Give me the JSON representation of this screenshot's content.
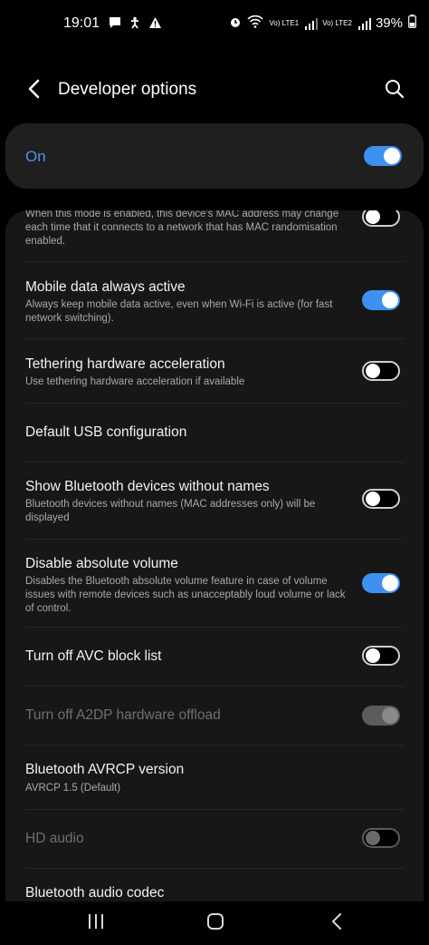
{
  "status_bar": {
    "time": "19:01",
    "left_icons": [
      "chat-icon",
      "accessibility-icon",
      "warning-icon"
    ],
    "right_icons": [
      "alarm-icon",
      "wifi-icon",
      "signal-icon"
    ],
    "sim1_label": "Vo) LTE1",
    "sim2_label": "Vo) LTE2",
    "battery": "39%"
  },
  "header": {
    "title": "Developer options",
    "back_icon": "back-icon",
    "search_icon": "search-icon"
  },
  "master_switch": {
    "label": "On",
    "state": "on"
  },
  "settings": [
    {
      "id": "mac-randomisation",
      "title": "",
      "subtitle": "When this mode is enabled, this device's MAC address may change each time that it connects to a network that has MAC randomisation enabled.",
      "toggle": "off"
    },
    {
      "id": "mobile-data-always-active",
      "title": "Mobile data always active",
      "subtitle": "Always keep mobile data active, even when Wi-Fi is active (for fast network switching).",
      "toggle": "on"
    },
    {
      "id": "tethering-hardware-acceleration",
      "title": "Tethering hardware acceleration",
      "subtitle": "Use tethering hardware acceleration if available",
      "toggle": "off"
    },
    {
      "id": "default-usb-configuration",
      "title": "Default USB configuration",
      "subtitle": "",
      "toggle": "none"
    },
    {
      "id": "show-bluetooth-devices-without-names",
      "title": "Show Bluetooth devices without names",
      "subtitle": "Bluetooth devices without names (MAC addresses only) will be displayed",
      "toggle": "off"
    },
    {
      "id": "disable-absolute-volume",
      "title": "Disable absolute volume",
      "subtitle": "Disables the Bluetooth absolute volume feature in case of volume issues with remote devices such as unacceptably loud volume or lack of control.",
      "toggle": "on"
    },
    {
      "id": "turn-off-avc-block-list",
      "title": "Turn off AVC block list",
      "subtitle": "",
      "toggle": "off"
    },
    {
      "id": "turn-off-a2dp-hardware-offload",
      "title": "Turn off A2DP hardware offload",
      "subtitle": "",
      "toggle": "disabled-on",
      "disabled": true
    },
    {
      "id": "bluetooth-avrcp-version",
      "title": "Bluetooth AVRCP version",
      "subtitle": "AVRCP 1.5 (Default)",
      "toggle": "none"
    },
    {
      "id": "hd-audio",
      "title": "HD audio",
      "subtitle": "",
      "toggle": "disabled-off",
      "disabled": true
    },
    {
      "id": "bluetooth-audio-codec",
      "title": "Bluetooth audio codec",
      "subtitle": "",
      "toggle": "none"
    }
  ],
  "colors": {
    "accent": "#3e91f0",
    "on_label": "#4a95ef",
    "background": "#000000",
    "panel": "#171717",
    "subtitle": "#a9a9a9"
  },
  "nav_bar": {
    "recents_icon": "recents-icon",
    "home_icon": "home-icon",
    "back_icon": "back-nav-icon"
  }
}
